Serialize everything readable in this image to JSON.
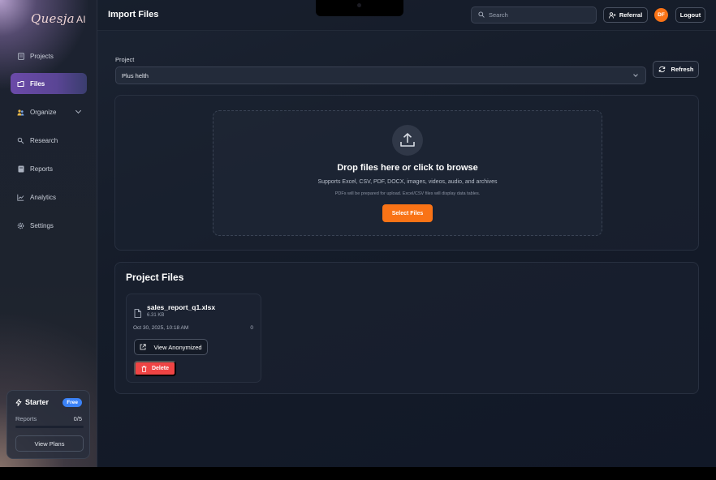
{
  "sidebar": {
    "logo": {
      "brand": "Quesja",
      "suffix": "AI"
    },
    "items": [
      {
        "label": "Projects",
        "icon": "document-icon"
      },
      {
        "label": "Files",
        "icon": "files-icon",
        "active": true
      },
      {
        "label": "Organize",
        "icon": "users-icon"
      },
      {
        "label": "Research",
        "icon": "research-icon"
      },
      {
        "label": "Reports",
        "icon": "reports-icon"
      },
      {
        "label": "Analytics",
        "icon": "chart-icon"
      },
      {
        "label": "Settings",
        "icon": "gear-icon"
      }
    ],
    "plan": {
      "name": "Starter",
      "badge": "Free",
      "usage_label": "Reports",
      "usage_value": "0/5",
      "usage_fraction": 0,
      "button": "View Plans"
    }
  },
  "header": {
    "title": "Import Files",
    "search_placeholder": "Search",
    "referral": "Referral",
    "avatar_initials": "DF",
    "logout": "Logout"
  },
  "main": {
    "project_label": "Project",
    "project_value": "Plus helth",
    "refresh": "Refresh",
    "dropzone": {
      "title": "Drop files here or click to browse",
      "subtitle": "Supports Excel, CSV, PDF, DOCX, images, videos, audio, and archives",
      "note": "PDFs will be prepared for upload. Excel/CSV files will display data tables.",
      "button": "Select Files"
    },
    "files_section_title": "Project Files",
    "files": [
      {
        "name": "sales_report_q1.xlsx",
        "size": "6.31 KB",
        "date": "Oct 30, 2025, 10:18 AM",
        "count": "0",
        "view_button": "View Anonymized",
        "delete_button": "Delete"
      }
    ]
  },
  "colors": {
    "accent": "#f97316",
    "danger": "#ef4444",
    "active_nav": "#6b4aa8",
    "badge": "#3b82f6"
  }
}
